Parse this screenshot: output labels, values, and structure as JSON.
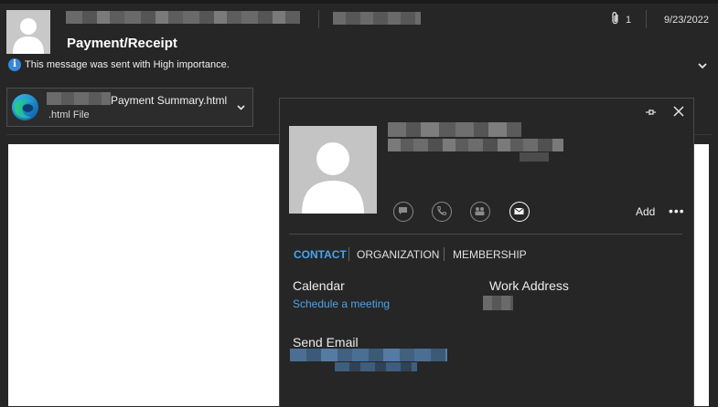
{
  "message": {
    "subject": "Payment/Receipt",
    "importance_note": "This message was sent with High importance.",
    "attachment_count": "1",
    "date": "9/23/2022"
  },
  "attachment": {
    "name": "Payment Summary.html",
    "type": ".html File"
  },
  "contact_card": {
    "actions": [
      "im-icon",
      "call-icon",
      "video-icon",
      "mail-icon"
    ],
    "add_label": "Add",
    "more_label": "•••",
    "tabs": [
      {
        "label": "CONTACT",
        "active": true
      },
      {
        "label": "ORGANIZATION",
        "active": false
      },
      {
        "label": "MEMBERSHIP",
        "active": false
      }
    ],
    "calendar_label": "Calendar",
    "schedule_link": "Schedule a meeting",
    "work_address_label": "Work Address",
    "send_email_label": "Send Email"
  },
  "colors": {
    "background": "#262626",
    "accent": "#4aa3ef",
    "info_icon": "#3a86d9"
  }
}
